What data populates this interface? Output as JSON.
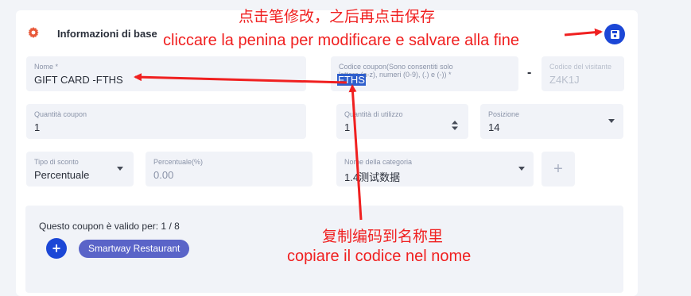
{
  "section": {
    "title": "Informazioni di base"
  },
  "fields": {
    "name": {
      "label": "Nome *",
      "value": "GIFT CARD -FTHS"
    },
    "coupon_code": {
      "label": "Codice coupon(Sono consentiti solo lettere (a-z), numeri (0-9), (.) e (-)) *",
      "value": "FTHS"
    },
    "code_preview": {
      "label": "Codice del visitante",
      "value": "Z4K1J"
    },
    "coupon_qty": {
      "label": "Quantità coupon",
      "value": "1"
    },
    "usage_qty": {
      "label": "Quantità di utilizzo",
      "value": "1"
    },
    "position": {
      "label": "Posizione",
      "value": "14"
    },
    "discount_type": {
      "label": "Tipo di sconto",
      "value": "Percentuale"
    },
    "percentage": {
      "label": "Percentuale(%)",
      "value": "0.00"
    },
    "category": {
      "label": "Nome della categoria",
      "value": "1.4测试数据"
    }
  },
  "separator": "-",
  "add_symbol": "+",
  "validity": {
    "text": "Questo coupon è valido per: 1 / 8",
    "chip": "Smartway Restaurant"
  },
  "annotations": {
    "top_zh": "点击笔修改，之后再点击保存",
    "top_it": "cliccare la penina per modificare e salvare alla fine",
    "bottom_zh": "复制编码到名称里",
    "bottom_it": "copiare il codice nel nome"
  },
  "colors": {
    "accent": "#1c47d6",
    "chip": "#5a64c8",
    "annotation": "#f02020",
    "gear": "#e8593a"
  }
}
